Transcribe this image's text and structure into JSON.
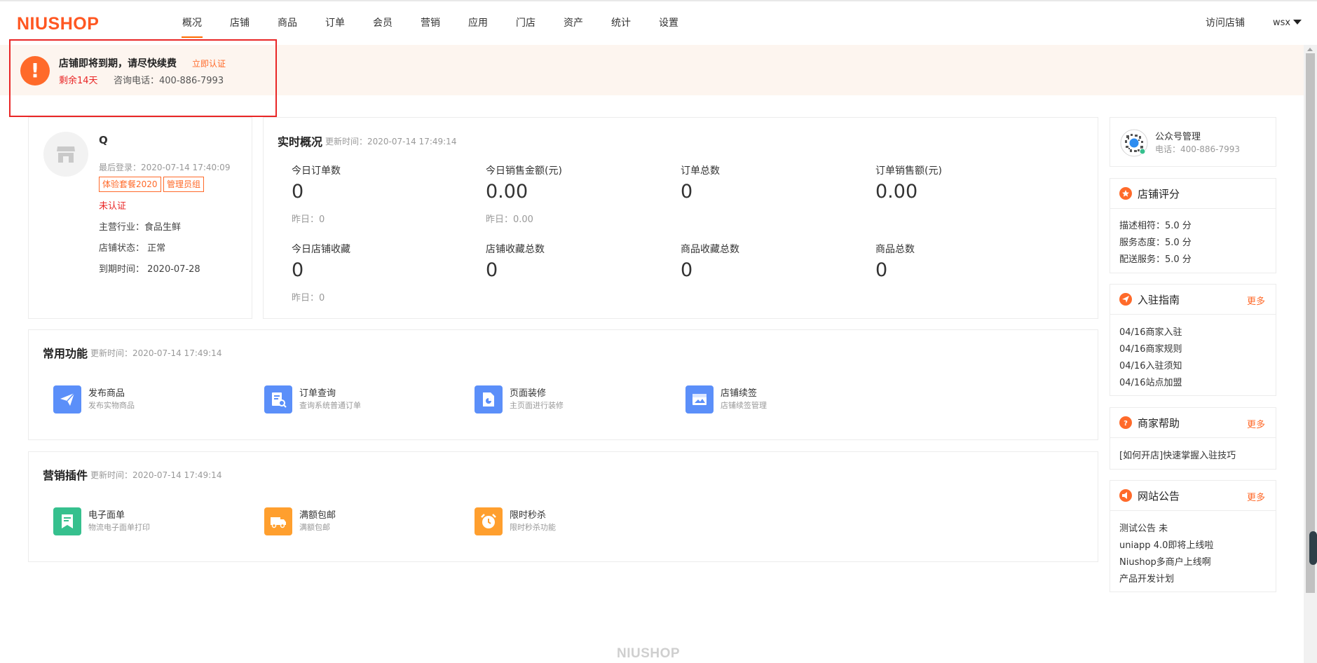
{
  "header": {
    "logo": "NIUSHOP",
    "nav": [
      "概况",
      "店铺",
      "商品",
      "订单",
      "会员",
      "营销",
      "应用",
      "门店",
      "资产",
      "统计",
      "设置"
    ],
    "active_index": 0,
    "visit_store": "访问店铺",
    "username": "wsx"
  },
  "notice": {
    "title": "店铺即将到期，请尽快续费",
    "link": "立即认证",
    "days_left": "剩余14天",
    "phone": "咨询电话：400-886-7993"
  },
  "profile": {
    "name": "Q",
    "last_login": "最后登录：2020-07-14 17:40:09",
    "tags": [
      "体验套餐2020",
      "管理员组"
    ],
    "status_label": "未认证",
    "industry": "主营行业：食品生鲜",
    "store_status": "店铺状态： 正常",
    "expire": "到期时间： 2020-07-28"
  },
  "realtime": {
    "title": "实时概况",
    "update_time": "更新时间：2020-07-14 17:49:14",
    "stats_row1": [
      {
        "label": "今日订单数",
        "value": "0",
        "sub": "昨日：0"
      },
      {
        "label": "今日销售金额(元)",
        "value": "0.00",
        "sub": "昨日：0.00"
      },
      {
        "label": "订单总数",
        "value": "0",
        "sub": ""
      },
      {
        "label": "订单销售额(元)",
        "value": "0.00",
        "sub": ""
      }
    ],
    "stats_row2": [
      {
        "label": "今日店铺收藏",
        "value": "0",
        "sub": "昨日：0"
      },
      {
        "label": "店铺收藏总数",
        "value": "0",
        "sub": ""
      },
      {
        "label": "商品收藏总数",
        "value": "0",
        "sub": ""
      },
      {
        "label": "商品总数",
        "value": "0",
        "sub": ""
      }
    ]
  },
  "common": {
    "title": "常用功能",
    "update_time": "更新时间：2020-07-14 17:49:14",
    "items": [
      {
        "name": "发布商品",
        "desc": "发布实物商品",
        "icon": "send-icon",
        "color": "#5b8ff9"
      },
      {
        "name": "订单查询",
        "desc": "查询系统普通订单",
        "icon": "order-search-icon",
        "color": "#5b8ff9"
      },
      {
        "name": "页面装修",
        "desc": "主页面进行装修",
        "icon": "page-design-icon",
        "color": "#5b8ff9"
      },
      {
        "name": "店铺续签",
        "desc": "店铺续签管理",
        "icon": "store-renew-icon",
        "color": "#5b8ff9"
      }
    ]
  },
  "marketing": {
    "title": "营销插件",
    "update_time": "更新时间：2020-07-14 17:49:14",
    "items": [
      {
        "name": "电子面单",
        "desc": "物流电子面单打印",
        "icon": "waybill-icon",
        "color": "#36c08e"
      },
      {
        "name": "满额包邮",
        "desc": "满额包邮",
        "icon": "truck-icon",
        "color": "#ff9f2e"
      },
      {
        "name": "限时秒杀",
        "desc": "限时秒杀功能",
        "icon": "alarm-clock-icon",
        "color": "#ff9f2e"
      }
    ]
  },
  "sidebar": {
    "wechat": {
      "title": "公众号管理",
      "phone": "电话：400-886-7993"
    },
    "rating": {
      "title": "店铺评分",
      "lines": [
        "描述相符：5.0 分",
        "服务态度：5.0 分",
        "配送服务：5.0 分"
      ]
    },
    "guide": {
      "title": "入驻指南",
      "more": "更多",
      "lines": [
        "04/16商家入驻",
        "04/16商家规则",
        "04/16入驻须知",
        "04/16站点加盟"
      ]
    },
    "help": {
      "title": "商家帮助",
      "more": "更多",
      "lines": [
        "[如何开店]快速掌握入驻技巧"
      ]
    },
    "announce": {
      "title": "网站公告",
      "more": "更多",
      "lines": [
        "测试公告 未",
        "uniapp 4.0即将上线啦",
        "Niushop多商户上线啊",
        "产品开发计划"
      ]
    }
  },
  "footer": {
    "logo": "NIUSHOP"
  },
  "colors": {
    "accent": "#ff6a2a",
    "danger": "#e92626",
    "brand": "#ff5722"
  }
}
